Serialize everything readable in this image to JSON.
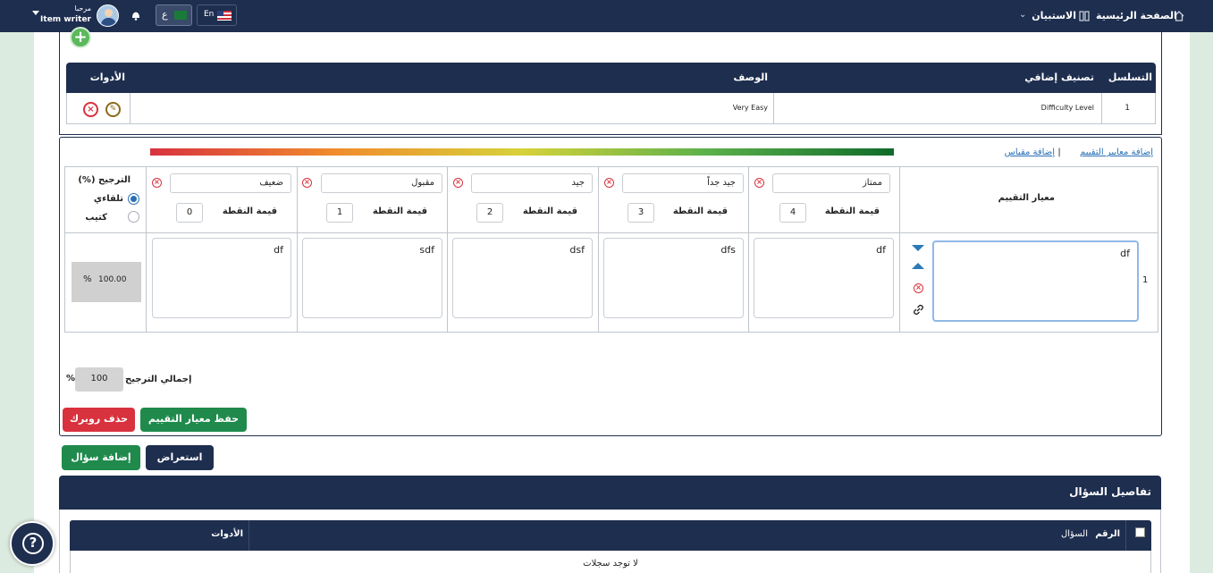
{
  "topbar": {
    "home_label": "الصفحة الرئيسية",
    "survey_label": "الاستبيان",
    "lang_ar": "ع",
    "lang_en": "En",
    "greeting": "مرحبا",
    "username": "Item writer"
  },
  "classification_table": {
    "headers": {
      "seq": "التسلسل",
      "extra": "تصنيف إضافي",
      "desc": "الوصف",
      "tools": "الأدوات"
    },
    "row": {
      "seq": "1",
      "extra": "Difficulty Level",
      "desc": "Very Easy"
    }
  },
  "rubric": {
    "add_criteria_link": "إضافة معايير التقييم",
    "separator": "|",
    "add_scale_link": "إضافة مقياس",
    "criteria_header": "معيار التقييم",
    "point_value_label": "قيمة النقطة",
    "levels": [
      {
        "name": "ممتاز",
        "points": "4"
      },
      {
        "name": "جيد جداً",
        "points": "3"
      },
      {
        "name": "جيد",
        "points": "2"
      },
      {
        "name": "مقبول",
        "points": "1"
      },
      {
        "name": "ضعيف",
        "points": "0"
      }
    ],
    "weight_header": "(%) الترجيح",
    "weight_auto": "تلقاءي",
    "weight_manual": "كتيب",
    "row_number": "1",
    "criterion_text": "df",
    "descriptions": [
      "df",
      "dfs",
      "dsf",
      "sdf",
      "df"
    ],
    "row_weight": "100.00",
    "percent": "%",
    "total_weight_label": "إجمالي الترجيح",
    "total_weight_value": "100",
    "save_button": "حفظ معيار التقييم",
    "delete_button": "حذف روبرك",
    "gradient_colors": [
      "#d8323e",
      "#f08c2d",
      "#d6d23a",
      "#5bb04a",
      "#0f6b2a"
    ]
  },
  "actions": {
    "preview_button": "استعراض",
    "add_question_button": "إضافة سؤال"
  },
  "question_details": {
    "title": "تفاصيل السؤال",
    "headers": {
      "num": "الرقم",
      "question": "السؤال",
      "tools": "الأدوات"
    },
    "empty": "لا توجد سجلات"
  },
  "colors": {
    "navy": "#1e2e4f",
    "green": "#1f8a4c",
    "red": "#d8323e"
  }
}
